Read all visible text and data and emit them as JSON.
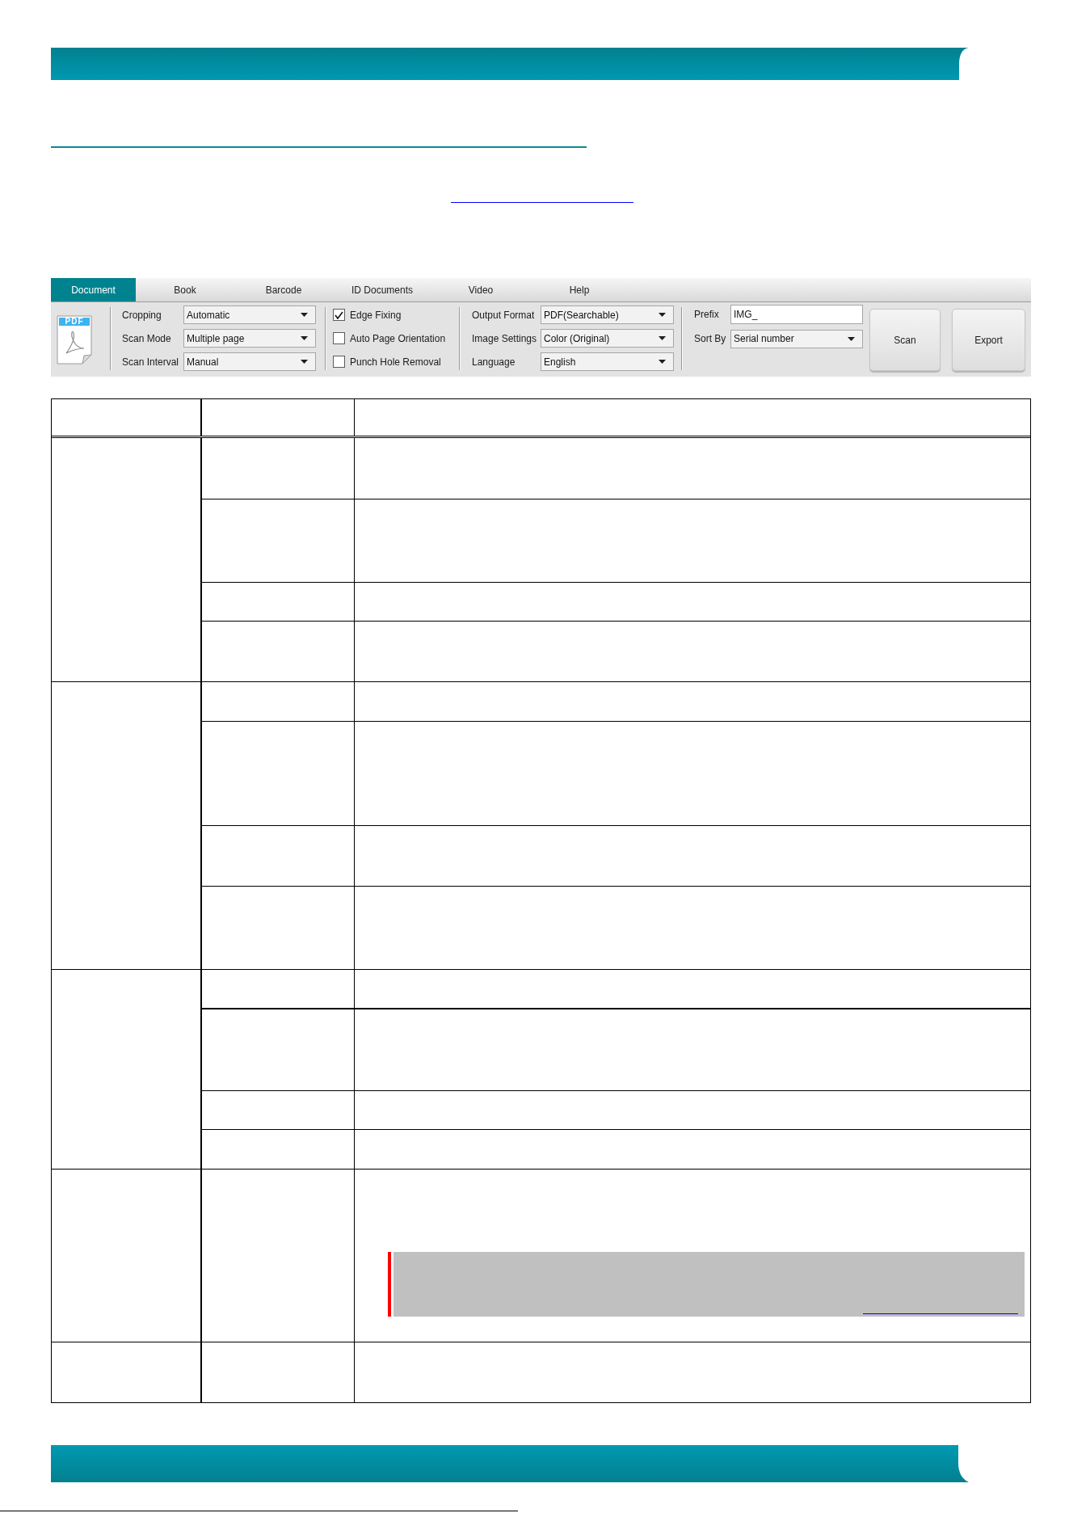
{
  "toolbar": {
    "tabs": [
      {
        "label": "Document",
        "selected": true
      },
      {
        "label": "Book",
        "selected": false
      },
      {
        "label": "Barcode",
        "selected": false
      },
      {
        "label": "ID Documents",
        "selected": false
      },
      {
        "label": "Video",
        "selected": false
      },
      {
        "label": "Help",
        "selected": false
      }
    ],
    "format_icon": {
      "label": "PDF"
    },
    "scan_fields": [
      {
        "label": "Cropping",
        "value": "Automatic"
      },
      {
        "label": "Scan Mode",
        "value": "Multiple page"
      },
      {
        "label": "Scan Interval",
        "value": "Manual"
      }
    ],
    "options": [
      {
        "label": "Edge Fixing",
        "checked": true
      },
      {
        "label": "Auto Page Orientation",
        "checked": false
      },
      {
        "label": "Punch Hole Removal",
        "checked": false
      }
    ],
    "output_fields": [
      {
        "label": "Output Format",
        "value": "PDF(Searchable)"
      },
      {
        "label": "Image Settings",
        "value": "Color (Original)"
      },
      {
        "label": "Language",
        "value": "English"
      }
    ],
    "prefix": {
      "label": "Prefix",
      "value": "IMG_"
    },
    "sort_by": {
      "label": "Sort By",
      "value": "Serial number"
    },
    "buttons": [
      "Scan",
      "Export"
    ]
  }
}
